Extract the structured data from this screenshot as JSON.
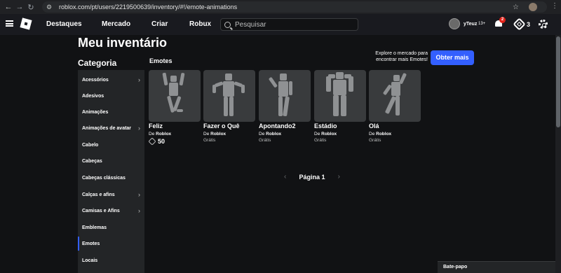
{
  "browser": {
    "url": "roblox.com/pt/users/2219500639/inventory/#!/emote-animations"
  },
  "header": {
    "nav": [
      "Destaques",
      "Mercado",
      "Criar",
      "Robux"
    ],
    "search_placeholder": "Pesquisar",
    "username": "yTeuz",
    "age_badge": "13+",
    "notifications": "2",
    "robux": "3"
  },
  "page": {
    "title": "Meu inventário",
    "promo_text": "Explore o mercado para encontrar mais Emotes!",
    "promo_button": "Obter mais"
  },
  "sidebar": {
    "title": "Categoria",
    "items": [
      {
        "label": "Acessórios",
        "chevron": true
      },
      {
        "label": "Adesivos",
        "chevron": false
      },
      {
        "label": "Animações",
        "chevron": false
      },
      {
        "label": "Animações de avatar",
        "chevron": true
      },
      {
        "label": "Cabelo",
        "chevron": false
      },
      {
        "label": "Cabeças",
        "chevron": false
      },
      {
        "label": "Cabeças clássicas",
        "chevron": false
      },
      {
        "label": "Calças e afins",
        "chevron": true
      },
      {
        "label": "Camisas e Afins",
        "chevron": true
      },
      {
        "label": "Emblemas",
        "chevron": false
      },
      {
        "label": "Emotes",
        "chevron": false,
        "active": true
      },
      {
        "label": "Locais",
        "chevron": false
      }
    ]
  },
  "main": {
    "section": "Emotes",
    "cards": [
      {
        "name": "Feliz",
        "creator_prefix": "De",
        "creator": "Roblox",
        "price": "50",
        "robux": true
      },
      {
        "name": "Fazer o Quê",
        "creator_prefix": "De",
        "creator": "Roblox",
        "price": "Grátis",
        "robux": false
      },
      {
        "name": "Apontando2",
        "creator_prefix": "De",
        "creator": "Roblox",
        "price": "Grátis",
        "robux": false
      },
      {
        "name": "Estádio",
        "creator_prefix": "De",
        "creator": "Roblox",
        "price": "Grátis",
        "robux": false
      },
      {
        "name": "Olá",
        "creator_prefix": "De",
        "creator": "Roblox",
        "price": "Grátis",
        "robux": false
      }
    ],
    "pager": {
      "label": "Página 1"
    }
  },
  "chat": {
    "label": "Bate-papo"
  },
  "colors": {
    "accent": "#335fff",
    "background": "#111214",
    "card": "#393b3d"
  }
}
